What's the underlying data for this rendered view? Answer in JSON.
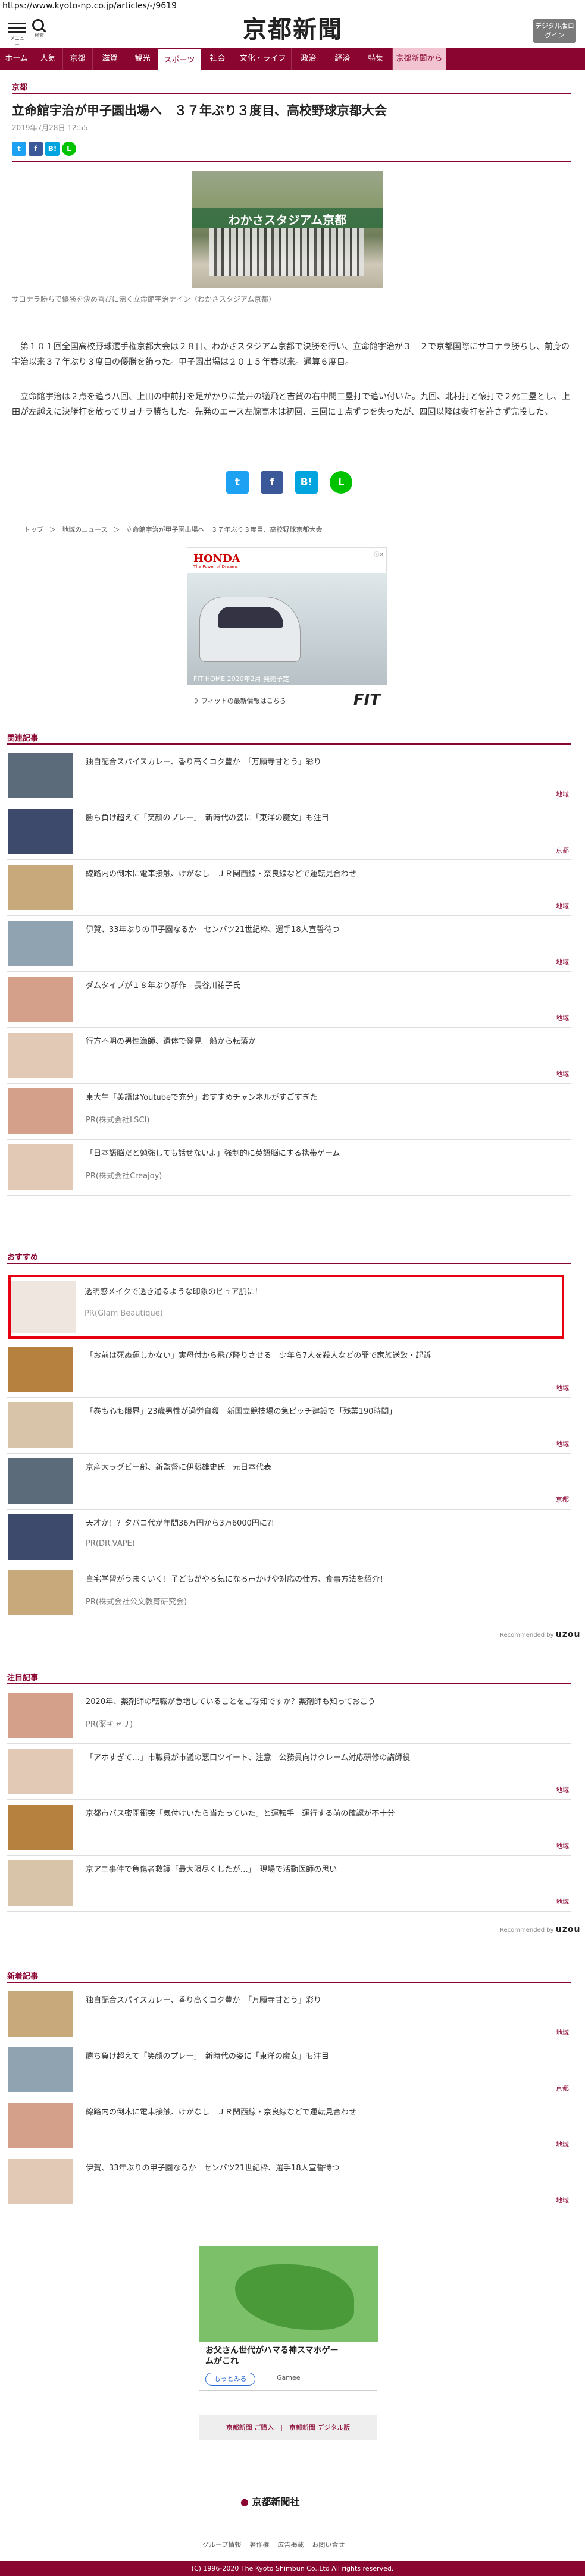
{
  "url": "https://www.kyoto-np.co.jp/articles/-/9619",
  "header": {
    "menu_label": "メニュー",
    "search_label": "検索",
    "logo": "京都新聞",
    "digital_button": "デジタル版ログイン"
  },
  "nav": [
    "ホーム",
    "人気",
    "京都",
    "滋賀",
    "観光",
    "スポーツ",
    "社会",
    "文化・ライフ",
    "政治",
    "経済",
    "特集",
    "京都新聞から"
  ],
  "article": {
    "category": "京都",
    "title": "立命館宇治が甲子園出場へ　３７年ぶり３度目、高校野球京都大会",
    "date": "2019年7月28日 12:55",
    "photo_banner": "わかさスタジアム京都",
    "caption": "サヨナラ勝ちで優勝を決め喜びに沸く立命館宇治ナイン（わかさスタジアム京都）",
    "p1": "第１０１回全国高校野球選手権京都大会は２８日、わかさスタジアム京都で決勝を行い、立命館宇治が３－２で京都国際にサヨナラ勝ちし、前身の宇治以来３７年ぶり３度目の優勝を飾った。甲子園出場は２０１５年春以来。通算６度目。",
    "p2": "立命館宇治は２点を追う八回、上田の中前打を足がかりに荒井の犠飛と吉賀の右中間三塁打で追い付いた。九回、北村打と懐打で２死三塁とし、上田が左越えに決勝打を放ってサヨナラ勝ちした。先発のエース左腕高木は初回、三回に１点ずつを失ったが、四回以降は安打を許さず完投した。"
  },
  "share_icons": [
    "twitter-icon",
    "facebook-icon",
    "hatena-icon",
    "line-icon"
  ],
  "breadcrumb": [
    "トップ",
    "＞",
    "地域のニュース",
    "＞",
    "立命館宇治が甲子園出場へ　３７年ぶり３度目、高校野球京都大会"
  ],
  "ad1": {
    "brand": "HONDA",
    "tagline": "The Power of Dreams",
    "text": "FIT HOME 2020年2月 発売予定",
    "footer": "》フィットの最新情報はこちら",
    "logo": "FIT"
  },
  "related": {
    "heading": "関連記事",
    "items": [
      {
        "title": "独自配合スパイスカレー、香り高くコク豊か　「万願寺甘とう」彩り",
        "tag": "地域"
      },
      {
        "title": "勝ち負け超えて「笑顔のプレー」　新時代の姿に「東洋の魔女」も注目",
        "tag": "京都"
      },
      {
        "title": "線路内の倒木に電車接触、けがなし　ＪＲ関西線・奈良線などで運転見合わせ",
        "tag": "地域"
      },
      {
        "title": "伊賀、33年ぶりの甲子園なるか　センバツ21世紀枠、選手18人宣誓待つ",
        "tag": "地域"
      },
      {
        "title": "ダムタイプが１８年ぶり新作　長谷川祐子氏",
        "tag": "地域"
      },
      {
        "title": "行方不明の男性漁師、遺体で発見　船から転落か",
        "tag": "地域"
      }
    ],
    "pr": [
      {
        "title": "東大生「英語はYoutubeで充分」おすすめチャンネルがすごすぎた",
        "pr": "PR(株式会社LSCI)"
      },
      {
        "title": "「日本語脳だと勉強しても話せないよ」強制的に英語脳にする携帯ゲーム",
        "pr": "PR(株式会社Creajoy)"
      }
    ]
  },
  "recommend": {
    "heading": "おすすめ",
    "highlight": {
      "title": "透明感メイクで透き通るような印象のピュア肌に！",
      "pr": "PR(Glam Beautique)"
    },
    "items": [
      {
        "title": "「お前は死ぬ運しかない」実母付から飛び降りさせる　少年ら7人を殺人などの罪で家族送致・起訴",
        "tag": "地域"
      },
      {
        "title": "「巻も心も限界」23歳男性が過労自殺　新国立競技場の急ピッチ建設で「残業190時間」",
        "tag": "地域"
      },
      {
        "title": "京産大ラグビー部、新監督に伊藤雄史氏　元日本代表",
        "tag": "京都"
      },
      {
        "title": "天才か！？タバコ代が年間36万円から3万6000円に?!",
        "pr": "PR(DR.VAPE)"
      },
      {
        "title": "自宅学習がうまくいく！子どもがやる気になる声かけや対応の仕方、食事方法を紹介！",
        "pr": "PR(株式会社公文教育研究会)"
      }
    ],
    "by": "Recommended by",
    "by_brand": "uzou"
  },
  "attention": {
    "heading": "注目記事",
    "items": [
      {
        "title": "2020年、薬剤師の転職が急増していることをご存知ですか？薬剤師も知っておこう",
        "pr": "PR(薬キャリ)"
      },
      {
        "title": "「アホすぎて…」市職員が市議の悪口ツイート、注意　公務員向けクレーム対応研修の講師役",
        "tag": "地域"
      },
      {
        "title": "京都市バス密閉衝突「気付けいたら当たっていた」と運転手　運行する前の確認が不十分",
        "tag": "地域"
      },
      {
        "title": "京アニ事件で負傷者救護「最大限尽くしたが…」　現場で活動医師の思い",
        "tag": "地域"
      }
    ],
    "by": "Recommended by",
    "by_brand": "uzou"
  },
  "latest": {
    "heading": "新着記事",
    "items": [
      {
        "title": "独自配合スパイスカレー、香り高くコク豊か　「万願寺甘とう」彩り",
        "tag": "地域"
      },
      {
        "title": "勝ち負け超えて「笑顔のプレー」　新時代の姿に「東洋の魔女」も注目",
        "tag": "京都"
      },
      {
        "title": "線路内の倒木に電車接触、けがなし　ＪＲ関西線・奈良線などで運転見合わせ",
        "tag": "地域"
      },
      {
        "title": "伊賀、33年ぶりの甲子園なるか　センバツ21世紀枠、選手18人宣誓待つ",
        "tag": "地域"
      }
    ]
  },
  "ad2": {
    "title": "お父さん世代がハマる神スマホゲームがこれ",
    "button": "もっとみる",
    "brand": "Gamee"
  },
  "links_box": "京都新聞 ご購入　|　京都新聞 デジタル版",
  "footer": {
    "logo": "京都新聞社",
    "links": [
      "グループ情報",
      "著作権",
      "広告掲載",
      "お問い合せ"
    ],
    "copyright": "(C) 1996-2020 The Kyoto Shimbun Co.,Ltd All rights reserved."
  }
}
